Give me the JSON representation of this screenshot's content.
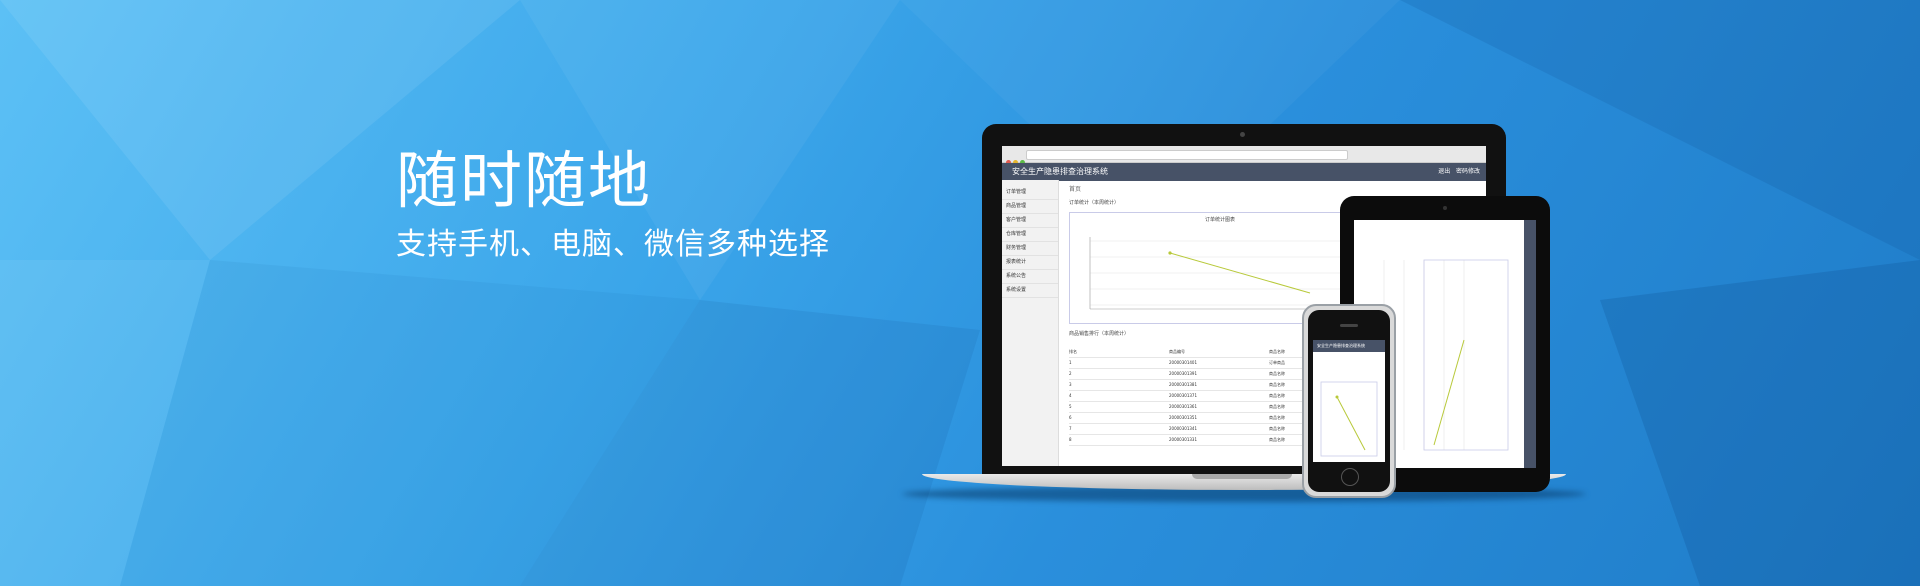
{
  "headline": {
    "title": "随时随地",
    "subtitle": "支持手机、电脑、微信多种选择"
  },
  "laptop_app": {
    "app_title": "安全生产隐患排查治理系统",
    "top_right": [
      "退出",
      "密码修改"
    ],
    "sidebar": [
      "订单管理",
      "商品管理",
      "客户管理",
      "仓库管理",
      "财务管理",
      "报表统计",
      "系统公告",
      "系统设置"
    ],
    "crumb": "首页",
    "panel_title": "订单统计（本周统计）",
    "chart_title": "订单统计图表",
    "table_title": "商品销售排行（本周统计）",
    "table_header": [
      "排名",
      "商品编号",
      "商品名称"
    ],
    "table_rows": [
      [
        "1",
        "20000301401",
        "订单商品"
      ],
      [
        "2",
        "20000301391",
        "商品名称"
      ],
      [
        "3",
        "20000301381",
        "商品名称"
      ],
      [
        "4",
        "20000301371",
        "商品名称"
      ],
      [
        "5",
        "20000301361",
        "商品名称"
      ],
      [
        "6",
        "20000301351",
        "商品名称"
      ],
      [
        "7",
        "20000301341",
        "商品名称"
      ],
      [
        "8",
        "20000301331",
        "商品名称"
      ]
    ]
  },
  "phone_app": {
    "app_title": "安全生产隐患排查治理系统"
  },
  "colors": {
    "app_bar": "#475267",
    "background_light": "#5cc0f5",
    "background_dark": "#1f7cc8",
    "chart_line": "#b8c93a"
  }
}
